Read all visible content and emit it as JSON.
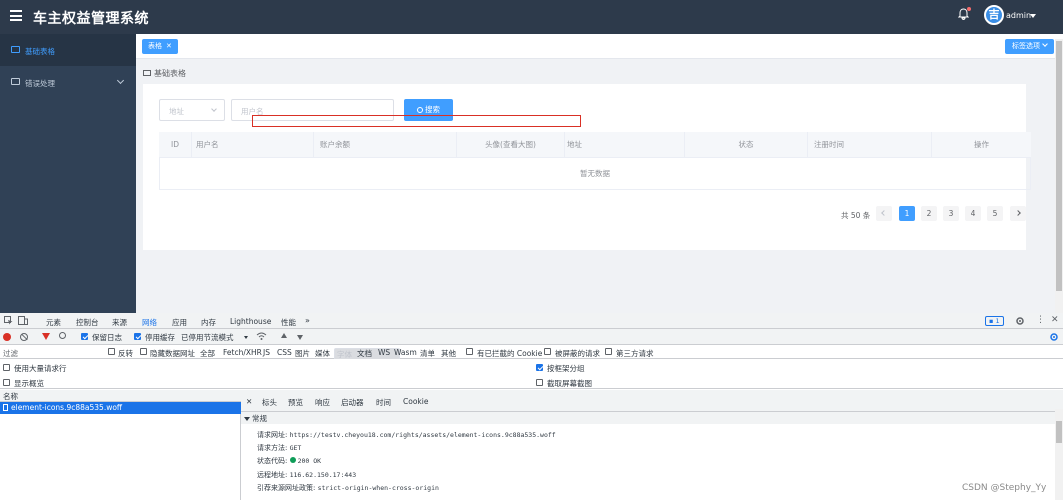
{
  "app": {
    "title": "车主权益管理系统",
    "username": "admin",
    "avatar_text": "吉"
  },
  "sidebar": {
    "items": [
      {
        "label": "基础表格"
      },
      {
        "label": "错误处理"
      }
    ]
  },
  "tags": {
    "active_tag": "表格",
    "options_label": "标签选项"
  },
  "breadcrumb": "基础表格",
  "search": {
    "select_placeholder": "地址",
    "input_placeholder": "用户名",
    "button": "搜索"
  },
  "table": {
    "columns": [
      "ID",
      "用户名",
      "账户余额",
      "头像(查看大图)",
      "地址",
      "状态",
      "注册时间",
      "操作"
    ],
    "empty_text": "暂无数据"
  },
  "pagination": {
    "total": "共 50 条",
    "pages": [
      "1",
      "2",
      "3",
      "4",
      "5"
    ],
    "current": "1"
  },
  "devtools": {
    "tabs": [
      "元素",
      "控制台",
      "来源",
      "网络",
      "应用",
      "内存",
      "Lighthouse",
      "性能"
    ],
    "active_tab": "网络",
    "issues_count": "1",
    "toolbar": {
      "preserve_log": "保留日志",
      "disable_cache": "停用缓存",
      "throttle": "已停用节流模式"
    },
    "filter": {
      "placeholder": "过滤",
      "invert": "反转",
      "hide_data_urls": "隐藏数据网址",
      "types": [
        "全部",
        "Fetch/XHR",
        "JS",
        "CSS",
        "图片",
        "媒体",
        "字体",
        "文档",
        "WS",
        "Wasm",
        "清单",
        "其他"
      ],
      "selected_type": "字体",
      "blocked_cookies": "有已拦截的 Cookie",
      "blocked_requests": "被屏蔽的请求",
      "third_party": "第三方请求"
    },
    "options": {
      "large_rows": "使用大量请求行",
      "overview": "显示概览",
      "group_by_frame": "按框架分组",
      "screenshots": "截取屏幕截图"
    },
    "request_list": {
      "header": "名称",
      "selected": "element-icons.9c88a535.woff"
    },
    "detail_tabs": [
      "标头",
      "预览",
      "响应",
      "启动器",
      "时间",
      "Cookie"
    ],
    "general": {
      "heading": "常规",
      "url_label": "请求网址:",
      "url": "https://testv.cheyou18.com/rights/assets/element-icons.9c88a535.woff",
      "method_label": "请求方法:",
      "method": "GET",
      "status_label": "状态代码:",
      "status": "200 OK",
      "remote_label": "远程地址:",
      "remote": "116.62.150.17:443",
      "referrer_label": "引荐来源网址政策:",
      "referrer": "strict-origin-when-cross-origin"
    }
  },
  "watermark": "CSDN @Stephy_Yy",
  "colors": {
    "header": "#2d3a4b",
    "sidebar": "#304156",
    "primary": "#409eff",
    "devtools_blue": "#1a73e8"
  }
}
